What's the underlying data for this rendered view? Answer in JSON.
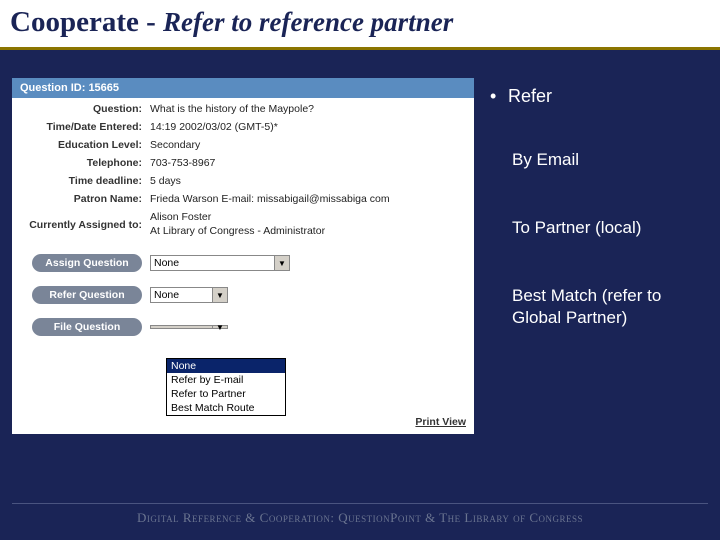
{
  "title": {
    "main": "Cooperate - ",
    "sub": "Refer to reference partner"
  },
  "question": {
    "header": "Question ID: 15665",
    "rows": {
      "question_label": "Question:",
      "question_value": "What is the history of the Maypole?",
      "time_label": "Time/Date Entered:",
      "time_value": "14:19 2002/03/02 (GMT-5)*",
      "edu_label": "Education Level:",
      "edu_value": "Secondary",
      "tel_label": "Telephone:",
      "tel_value": "703-753-8967",
      "deadline_label": "Time deadline:",
      "deadline_value": "5 days",
      "patron_label": "Patron Name:",
      "patron_value": "Frieda Warson   E-mail: missabigail@missabiga  com",
      "assigned_label": "Currently Assigned to:",
      "assigned_value_1": "Alison Foster",
      "assigned_value_2": "At Library of Congress - Administrator"
    },
    "buttons": {
      "assign": "Assign Question",
      "refer": "Refer Question",
      "file": "File Question"
    },
    "selects": {
      "assign_value": "None",
      "refer_value": "None",
      "file_value": ""
    },
    "dropdown_options": [
      "None",
      "Refer by E-mail",
      "Refer to Partner",
      "Best Match Route"
    ],
    "print": "Print View"
  },
  "bullets": {
    "main": "Refer",
    "sub1": "By Email",
    "sub2": "To Partner (local)",
    "sub3": "Best Match  (refer to Global Partner)"
  },
  "footer": "Digital Reference & Cooperation: QuestionPoint & The Library of Congress"
}
